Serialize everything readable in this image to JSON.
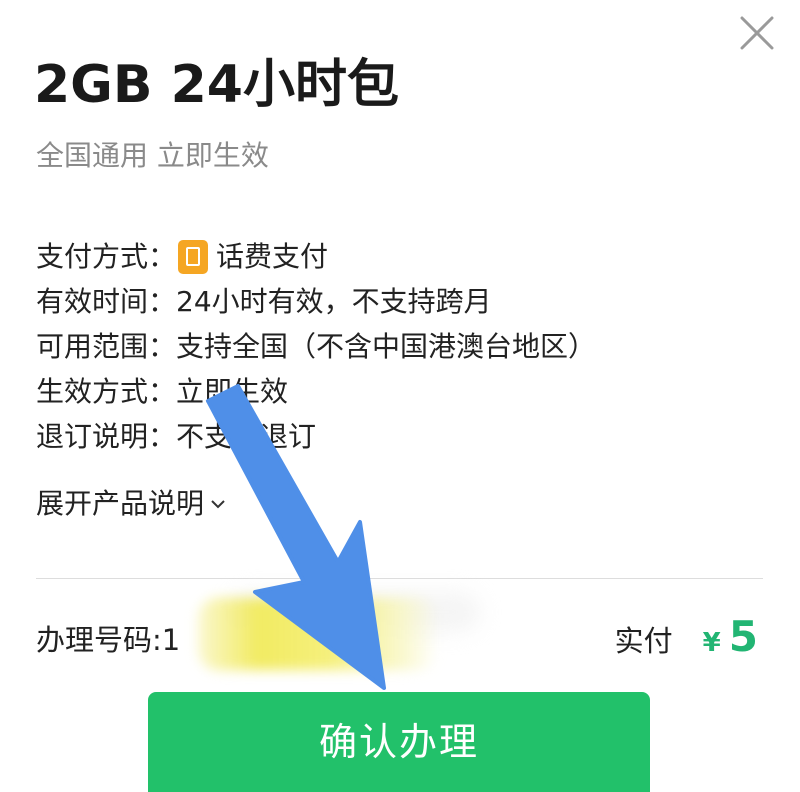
{
  "header": {
    "title": "2GB 24小时包",
    "subtitle": "全国通用 立即生效"
  },
  "close": {
    "icon": "close-icon"
  },
  "details": [
    {
      "label": "支付方式",
      "colon": "：",
      "value": "话费支付",
      "icon": "phone-bill-icon"
    },
    {
      "label": "有效时间",
      "colon": "：",
      "value": "24小时有效，不支持跨月"
    },
    {
      "label": "可用范围",
      "colon": "：",
      "value": "支持全国（不含中国港澳台地区）"
    },
    {
      "label": "生效方式",
      "colon": "：",
      "value": "立即生效"
    },
    {
      "label": "退订说明",
      "colon": "：",
      "value": "不支持退订"
    }
  ],
  "expand": {
    "label": "展开产品说明",
    "icon": "chevron-down-icon"
  },
  "footer": {
    "phone_label": "办理号码:1",
    "pay_label": "实付",
    "currency": "¥",
    "amount": "5",
    "confirm_label": "确认办理"
  },
  "colors": {
    "accent": "#22c16a",
    "price": "#22b573",
    "pay_icon": "#f5a623",
    "annotation_arrow": "#4f8fe8",
    "redaction": "#f1ea5a"
  }
}
